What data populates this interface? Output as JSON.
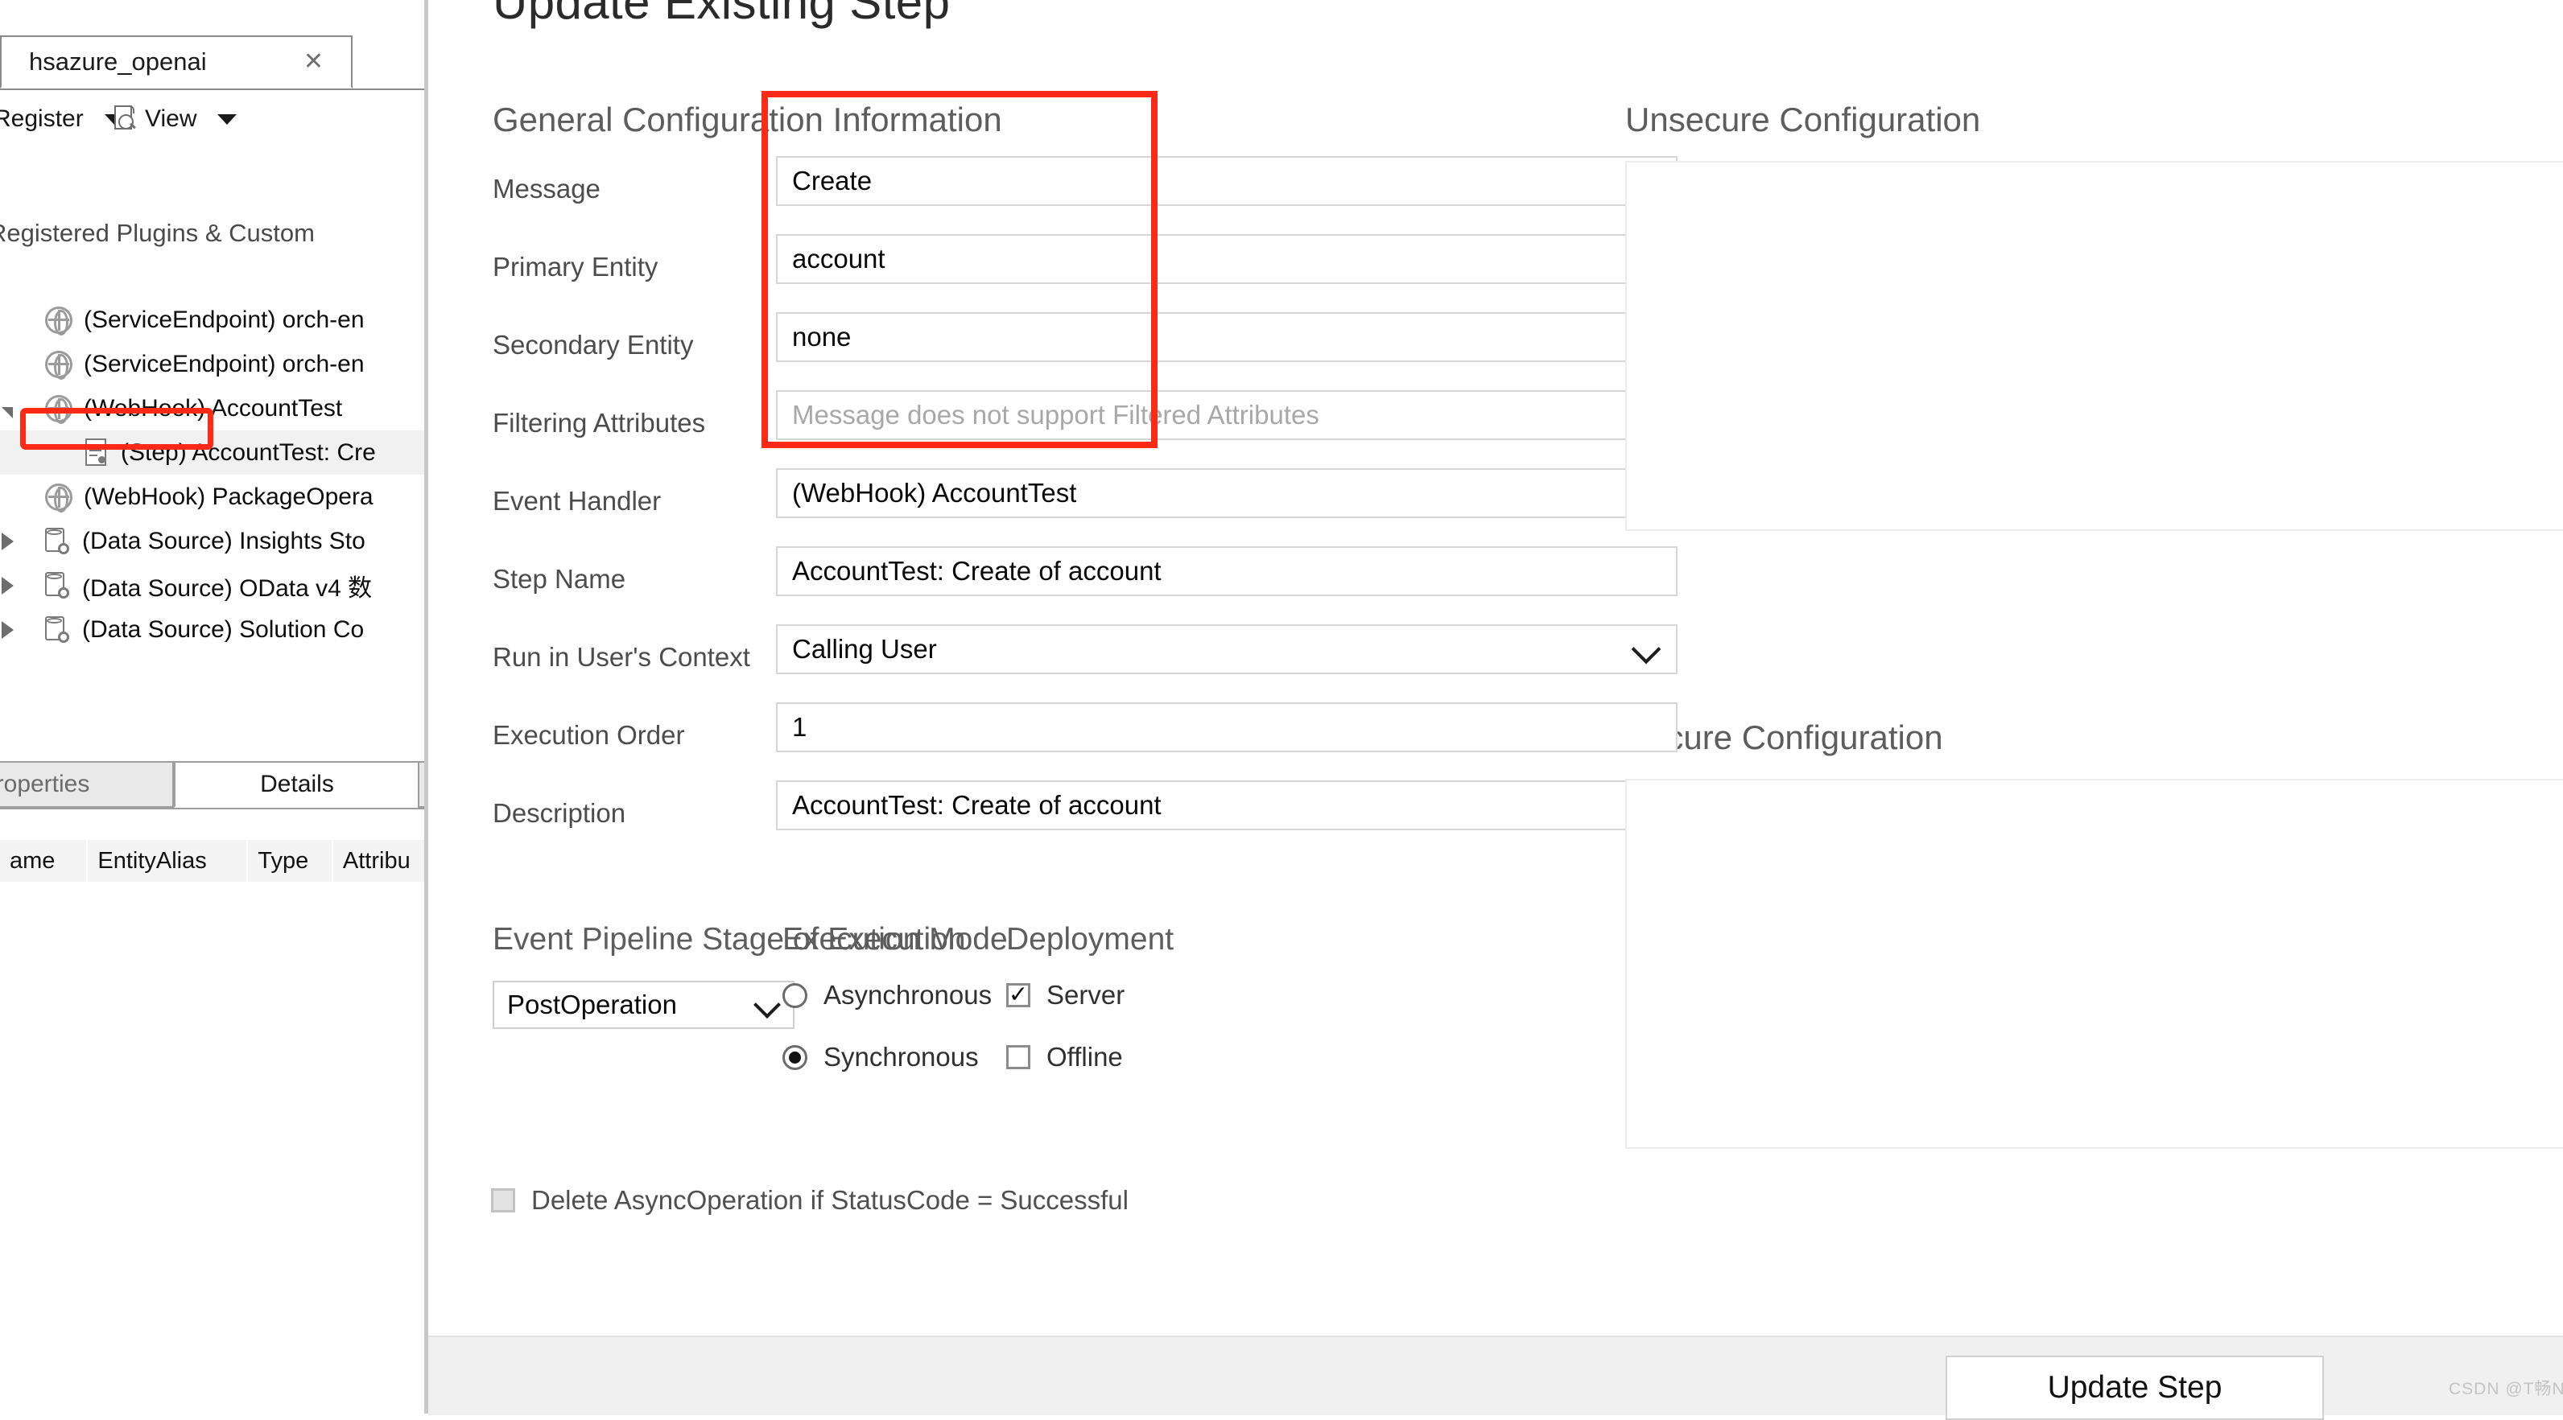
{
  "left_panel": {
    "connection_tab": {
      "label": "hsazure_openai",
      "close_icon": "close-icon"
    },
    "toolbar": {
      "register_label": "Register",
      "register_caret": "chevron-down-icon",
      "view_label": "View",
      "view_icon": "view-page-search-icon",
      "view_caret": "chevron-down-icon"
    },
    "tree_heading": "Registered Plugins & Custom",
    "tree_items": [
      {
        "label": "(ServiceEndpoint) orch-en",
        "icon": "globe-icon",
        "expander": "none",
        "indent": 56,
        "selected": false,
        "highlighted": false
      },
      {
        "label": "(ServiceEndpoint) orch-en",
        "icon": "globe-icon",
        "expander": "none",
        "indent": 56,
        "selected": false,
        "highlighted": false
      },
      {
        "label": "(WebHook) AccountTest",
        "icon": "globe-icon",
        "expander": "expanded",
        "indent": 56,
        "selected": false,
        "highlighted": true
      },
      {
        "label": "(Step) AccountTest: Cre",
        "icon": "step-icon",
        "expander": "none",
        "indent": 106,
        "selected": true,
        "highlighted": false
      },
      {
        "label": "(WebHook) PackageOpera",
        "icon": "globe-icon",
        "expander": "none",
        "indent": 56,
        "selected": false,
        "highlighted": false
      },
      {
        "label": "(Data Source) Insights Sto",
        "icon": "datasource-icon",
        "expander": "collapsed",
        "indent": 56,
        "selected": false,
        "highlighted": false
      },
      {
        "label": "(Data Source) OData v4 数",
        "icon": "datasource-icon",
        "expander": "collapsed",
        "indent": 56,
        "selected": false,
        "highlighted": false
      },
      {
        "label": "(Data Source) Solution Co",
        "icon": "datasource-icon",
        "expander": "collapsed",
        "indent": 56,
        "selected": false,
        "highlighted": false
      }
    ],
    "bottom_tabs": [
      {
        "label": "roperties",
        "active": false
      },
      {
        "label": "Details",
        "active": true
      }
    ],
    "grid_columns": [
      "ame",
      "EntityAlias",
      "Type",
      "Attribu"
    ]
  },
  "dialog": {
    "title": "Update Existing Step",
    "general_heading": "General Configuration Information",
    "unsecure_heading": "Unsecure  Configuration",
    "secure_heading": "Secure  Configuration",
    "unsecure_value": "",
    "secure_value": "",
    "fields": [
      {
        "label": "Message",
        "value": "Create",
        "kind": "text",
        "placeholder": false
      },
      {
        "label": "Primary Entity",
        "value": "account",
        "kind": "text",
        "placeholder": false
      },
      {
        "label": "Secondary Entity",
        "value": "none",
        "kind": "text",
        "placeholder": false
      },
      {
        "label": "Filtering Attributes",
        "value": "Message does not support Filtered Attributes",
        "kind": "text",
        "placeholder": true
      },
      {
        "label": "Event Handler",
        "value": "(WebHook) AccountTest",
        "kind": "dropdown",
        "placeholder": false
      },
      {
        "label": "Step Name",
        "value": "AccountTest: Create of account",
        "kind": "text",
        "placeholder": false
      },
      {
        "label": "Run in User's Context",
        "value": "Calling User",
        "kind": "dropdown",
        "placeholder": false
      },
      {
        "label": "Execution Order",
        "value": "1",
        "kind": "text",
        "placeholder": false
      },
      {
        "label": "Description",
        "value": "AccountTest: Create of account",
        "kind": "text",
        "placeholder": false
      }
    ],
    "stage": {
      "heading": "Event Pipeline Stage of Execution",
      "value": "PostOperation",
      "chevron_icon": "chevron-down-icon"
    },
    "execution_mode": {
      "heading": "Execution Mode",
      "options": [
        {
          "label": "Asynchronous",
          "checked": false
        },
        {
          "label": "Synchronous",
          "checked": true
        }
      ]
    },
    "deployment": {
      "heading": "Deployment",
      "options": [
        {
          "label": "Server",
          "checked": true
        },
        {
          "label": "Offline",
          "checked": false
        }
      ]
    },
    "delete_async": {
      "label": "Delete AsyncOperation if StatusCode = Successful",
      "checked": false,
      "disabled": true
    },
    "footer": {
      "update_button_label": "Update Step"
    },
    "watermark": "CSDN @T畅N",
    "highlight_color": "#fb2b18"
  }
}
